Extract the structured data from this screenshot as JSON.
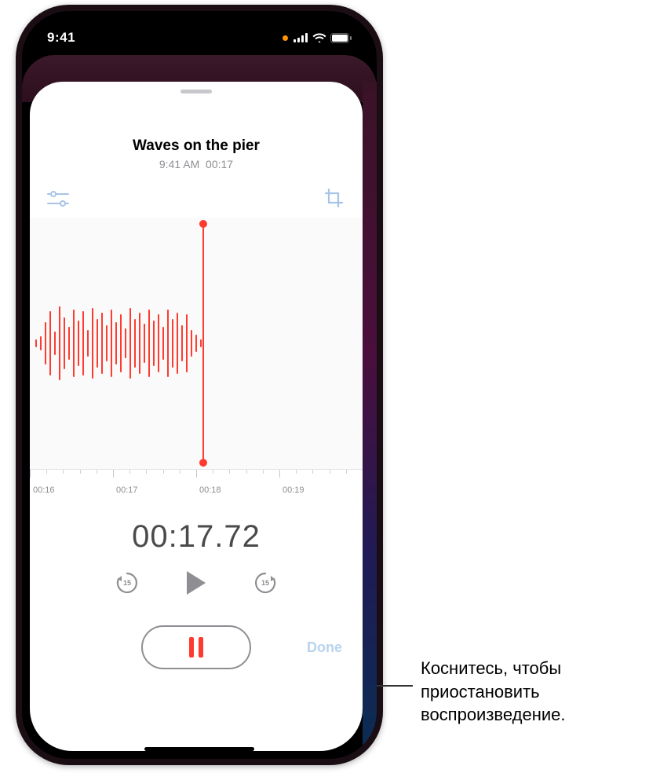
{
  "status": {
    "time": "9:41"
  },
  "recording": {
    "title": "Waves on the pier",
    "time_label": "9:41 AM",
    "duration_short": "00:17"
  },
  "ruler": {
    "t0": "00:16",
    "t1": "00:17",
    "t2": "00:18",
    "t3": "00:19"
  },
  "timer": "00:17.72",
  "skip_seconds": "15",
  "done_label": "Done",
  "callout": "Коснитесь, чтобы приостановить воспроизведение.",
  "colors": {
    "accent_red": "#ff3b30",
    "inactive_blue": "#a7c4e8"
  },
  "icons": {
    "settings": "settings-sliders-icon",
    "crop": "crop-icon",
    "skip_back": "skip-back-15-icon",
    "play": "play-icon",
    "skip_fwd": "skip-forward-15-icon",
    "pause": "pause-icon",
    "mic_active": "mic-active-dot"
  }
}
